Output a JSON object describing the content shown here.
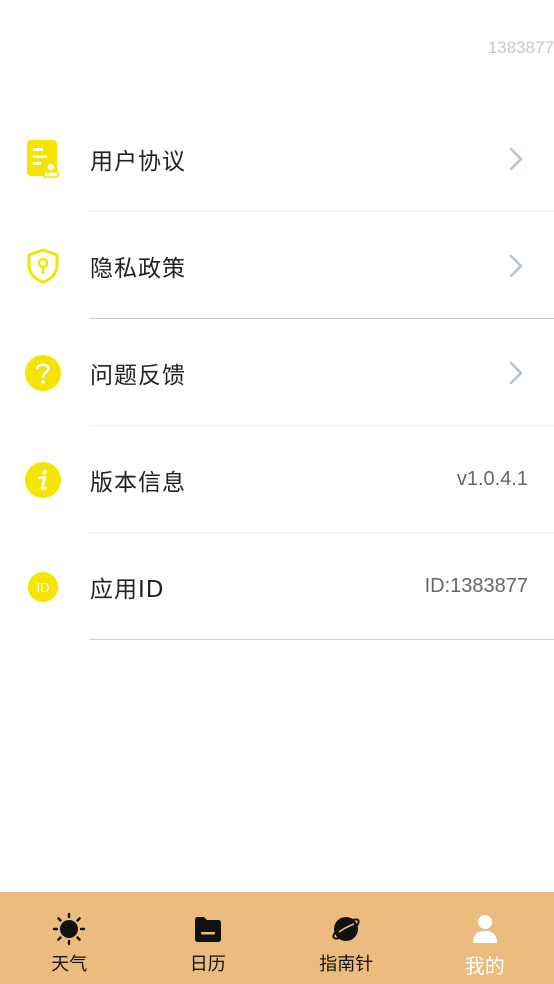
{
  "header": {
    "top_id": "1383877"
  },
  "menu": {
    "items": [
      {
        "label": "用户协议",
        "icon": "document-user-icon"
      },
      {
        "label": "隐私政策",
        "icon": "shield-lock-icon"
      },
      {
        "label": "问题反馈",
        "icon": "question-circle-icon"
      },
      {
        "label": "版本信息",
        "icon": "info-circle-icon",
        "value": "v1.0.4.1"
      },
      {
        "label": "应用ID",
        "icon": "id-badge-icon",
        "value": "ID:1383877"
      }
    ]
  },
  "tabbar": {
    "tabs": [
      {
        "label": "天气",
        "icon": "sun-icon"
      },
      {
        "label": "日历",
        "icon": "calendar-folder-icon"
      },
      {
        "label": "指南针",
        "icon": "planet-icon"
      },
      {
        "label": "我的",
        "icon": "person-icon",
        "active": true
      }
    ]
  },
  "colors": {
    "accent": "#f5e300",
    "tabbar_bg": "#ecbb7e",
    "chevron": "#b7c3d3"
  }
}
